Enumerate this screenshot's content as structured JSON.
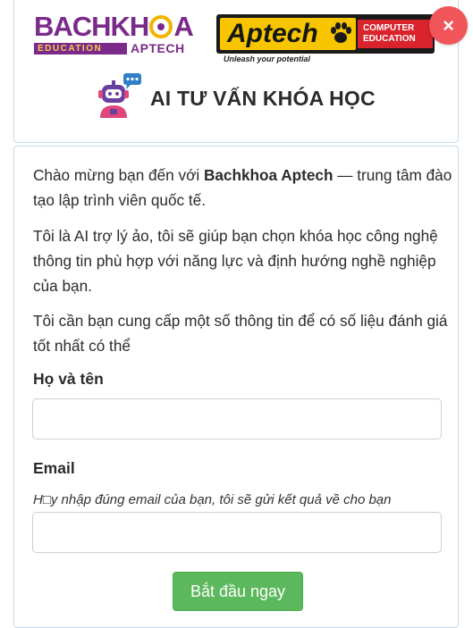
{
  "logos": {
    "bachkhoa": {
      "word_part1": "BACHKH",
      "word_part2": "A",
      "education": "EDUCATION",
      "aptech": "APTECH"
    },
    "aptech": {
      "name": "Aptech",
      "edu_line1": "COMPUTER",
      "edu_line2": "EDUCATION",
      "tagline": "Unleash your potential"
    }
  },
  "header": {
    "title": "AI TƯ VẤN KHÓA HỌC",
    "bot_icon": "robot-assistant-icon"
  },
  "close_button": {
    "label": "×"
  },
  "intro": {
    "p1_before": "Chào mừng bạn đến với ",
    "p1_brand": "Bachkhoa Aptech",
    "p1_after": " — trung tâm đào tạo lập trình viên quốc tế.",
    "p2": "Tôi là AI trợ lý ảo, tôi sẽ giúp bạn chọn khóa học công nghệ thông tin phù hợp với năng lực và định hướng nghề nghiệp của bạn.",
    "p3": "Tôi cần bạn cung cấp một số thông tin để có số liệu đánh giá tốt nhất có thể"
  },
  "form": {
    "name_label": "Họ và tên",
    "name_value": "",
    "email_label": "Email",
    "email_hint": "H□y nhập đúng email của bạn, tôi sẽ gửi kết quả về cho bạn",
    "email_value": "",
    "submit_label": "Bắt đầu ngay"
  },
  "colors": {
    "bachkhoa_purple": "#7b2a8a",
    "aptech_yellow": "#f7c600",
    "aptech_red": "#d9232d",
    "close_red": "#f0555a",
    "submit_green": "#5cb85c",
    "card_border": "#c9d9ea"
  }
}
